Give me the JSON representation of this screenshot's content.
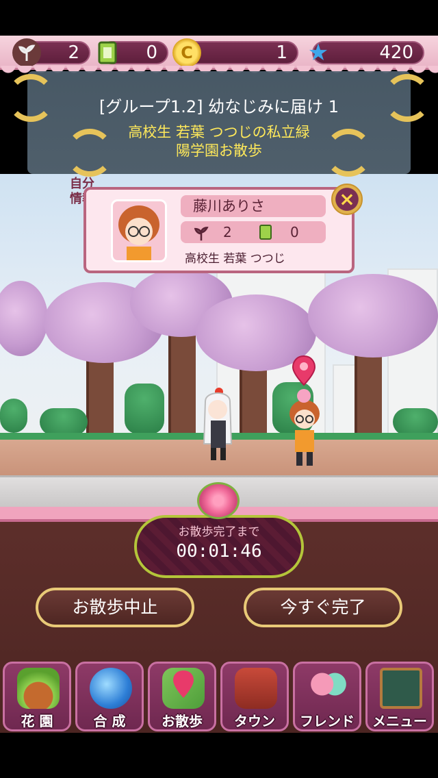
{
  "resources": {
    "seeds": "2",
    "cards": "0",
    "coins": "1",
    "stars": "420"
  },
  "banner": {
    "title": "[グループ1.2] 幼なじみに届け 1",
    "subtitle_line1": "高校生 若葉 つつじの私立緑",
    "subtitle_line2": "陽学園お散歩"
  },
  "info_card": {
    "side_label_line1": "自分",
    "side_label_line2": "情報",
    "name": "藤川ありさ",
    "seeds": "2",
    "cards": "0",
    "status": "高校生 若葉 つつじ",
    "close_label": "×"
  },
  "timer": {
    "label": "お散歩完了まで",
    "value": "00:01:46"
  },
  "actions": {
    "stop_label": "お散歩中止",
    "complete_label": "今すぐ完了"
  },
  "nav": [
    {
      "label": "花 園",
      "icon": "flowerpot-icon"
    },
    {
      "label": "合 成",
      "icon": "potion-icon"
    },
    {
      "label": "お散歩",
      "icon": "map-pin-icon"
    },
    {
      "label": "タウン",
      "icon": "castle-icon"
    },
    {
      "label": "フレンド",
      "icon": "friends-icon"
    },
    {
      "label": "メニュー",
      "icon": "menu-board-icon"
    }
  ],
  "colors": {
    "accent_pink": "#e9b4c6",
    "panel_brown": "#5e2f2b",
    "gold": "#e8c977",
    "banner_text": "#ffe95a"
  }
}
